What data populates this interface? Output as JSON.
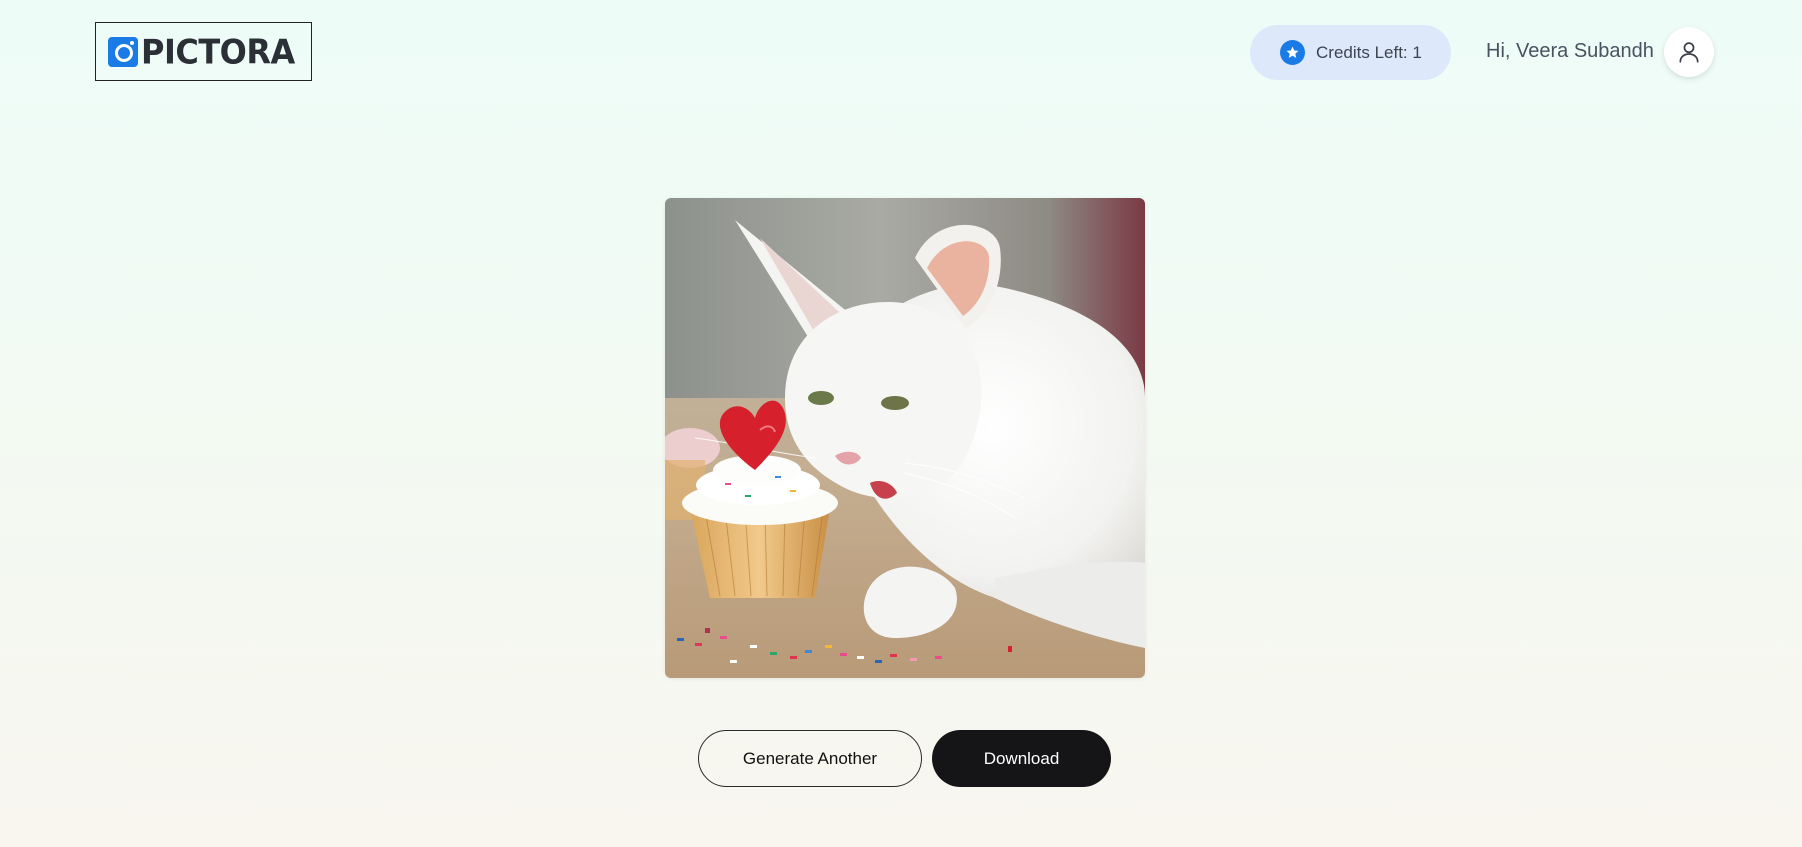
{
  "header": {
    "logo_text": "PICTORA",
    "credits_label": "Credits Left: 1",
    "greeting": "Hi, Veera Subandh"
  },
  "image": {
    "alt": "White cat sniffing a frosted cupcake topped with a strawberry heart and sprinkles"
  },
  "actions": {
    "generate_another_label": "Generate Another",
    "download_label": "Download"
  },
  "colors": {
    "brand_blue": "#1b7be6",
    "credits_pill_bg": "#dde9fb",
    "primary_button_bg": "#151518"
  },
  "icons": {
    "logo": "camera-icon",
    "credits": "star-icon",
    "profile": "user-icon"
  }
}
